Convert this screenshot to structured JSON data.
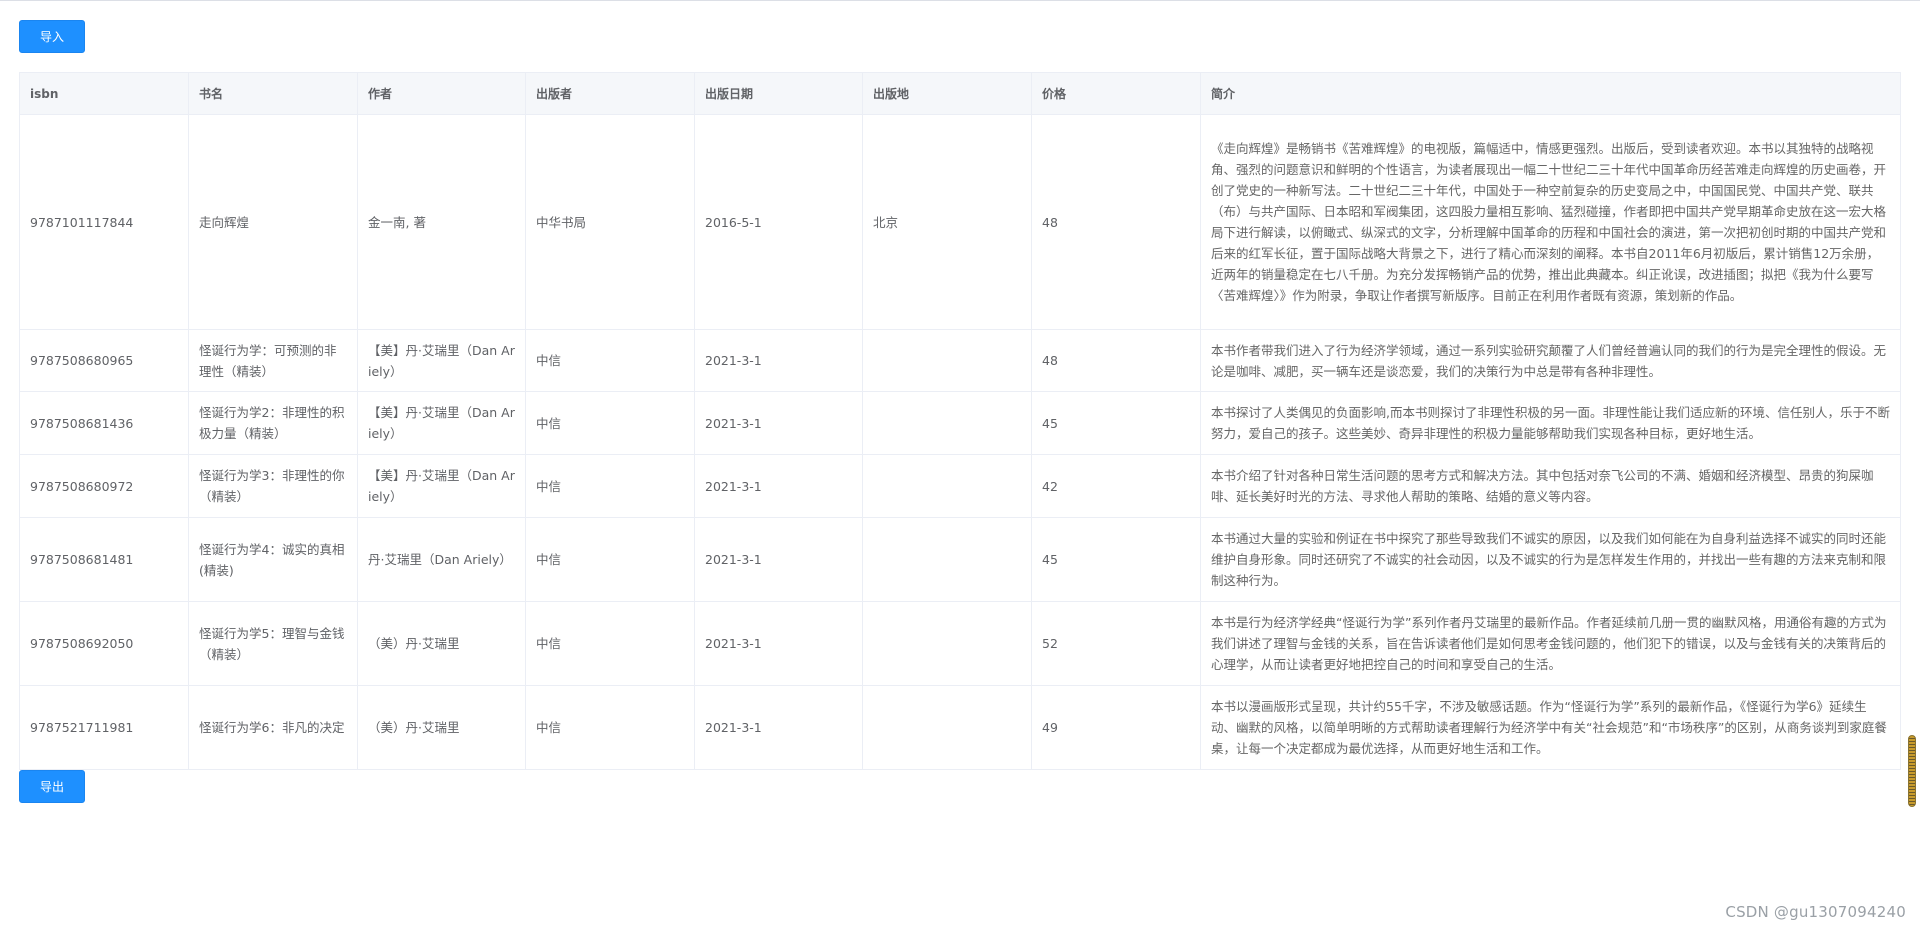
{
  "toolbar": {
    "import_label": "导入",
    "export_label": "导出"
  },
  "table": {
    "headers": [
      "isbn",
      "书名",
      "作者",
      "出版者",
      "出版日期",
      "出版地",
      "价格",
      "简介"
    ],
    "rows": [
      {
        "isbn": "9787101117844",
        "title": "走向辉煌",
        "author": "金一南, 著",
        "publisher": "中华书局",
        "date": "2016-5-1",
        "place": "北京",
        "price": "48",
        "desc": "《走向辉煌》是畅销书《苦难辉煌》的电视版，篇幅适中，情感更强烈。出版后，受到读者欢迎。本书以其独特的战略视角、强烈的问题意识和鲜明的个性语言，为读者展现出一幅二十世纪二三十年代中国革命历经苦难走向辉煌的历史画卷，开创了党史的一种新写法。二十世纪二三十年代，中国处于一种空前复杂的历史变局之中，中国国民党、中国共产党、联共（布）与共产国际、日本昭和军阀集团，这四股力量相互影响、猛烈碰撞，作者即把中国共产党早期革命史放在这一宏大格局下进行解读，以俯瞰式、纵深式的文字，分析理解中国革命的历程和中国社会的演进，第一次把初创时期的中国共产党和后来的红军长征，置于国际战略大背景之下，进行了精心而深刻的阐释。本书自2011年6月初版后，累计销售12万余册，近两年的销量稳定在七八千册。为充分发挥畅销产品的优势，推出此典藏本。纠正讹误，改进插图；拟把《我为什么要写〈苦难辉煌〉》作为附录，争取让作者撰写新版序。目前正在利用作者既有资源，策划新的作品。"
      },
      {
        "isbn": "9787508680965",
        "title": "怪诞行为学：可预测的非理性（精装）",
        "author": "【美】丹·艾瑞里（Dan Ariely）",
        "publisher": "中信",
        "date": "2021-3-1",
        "place": "",
        "price": "48",
        "desc": "本书作者带我们进入了行为经济学领域，通过一系列实验研究颠覆了人们曾经普遍认同的我们的行为是完全理性的假设。无论是咖啡、减肥，买一辆车还是谈恋爱，我们的决策行为中总是带有各种非理性。"
      },
      {
        "isbn": "9787508681436",
        "title": "怪诞行为学2：非理性的积极力量（精装）",
        "author": "【美】丹·艾瑞里（Dan Ariely）",
        "publisher": "中信",
        "date": "2021-3-1",
        "place": "",
        "price": "45",
        "desc": "本书探讨了人类偶见的负面影响,而本书则探讨了非理性积极的另一面。非理性能让我们适应新的环境、信任别人，乐于不断努力，爱自己的孩子。这些美妙、奇异非理性的积极力量能够帮助我们实现各种目标，更好地生活。"
      },
      {
        "isbn": "9787508680972",
        "title": "怪诞行为学3：非理性的你（精装）",
        "author": "【美】丹·艾瑞里（Dan Ariely）",
        "publisher": "中信",
        "date": "2021-3-1",
        "place": "",
        "price": "42",
        "desc": "本书介绍了针对各种日常生活问题的思考方式和解决方法。其中包括对奈飞公司的不满、婚姻和经济模型、昂贵的狗屎咖啡、延长美好时光的方法、寻求他人帮助的策略、结婚的意义等内容。"
      },
      {
        "isbn": "9787508681481",
        "title": "怪诞行为学4：诚实的真相(精装)",
        "author": "丹·艾瑞里（Dan Ariely）",
        "publisher": "中信",
        "date": "2021-3-1",
        "place": "",
        "price": "45",
        "desc": "本书通过大量的实验和例证在书中探究了那些导致我们不诚实的原因，以及我们如何能在为自身利益选择不诚实的同时还能维护自身形象。同时还研究了不诚实的社会动因，以及不诚实的行为是怎样发生作用的，并找出一些有趣的方法来克制和限制这种行为。"
      },
      {
        "isbn": "9787508692050",
        "title": "怪诞行为学5：理智与金钱（精装）",
        "author": "（美）丹·艾瑞里",
        "publisher": "中信",
        "date": "2021-3-1",
        "place": "",
        "price": "52",
        "desc": "本书是行为经济学经典“怪诞行为学”系列作者丹艾瑞里的最新作品。作者延续前几册一贯的幽默风格，用通俗有趣的方式为我们讲述了理智与金钱的关系，旨在告诉读者他们是如何思考金钱问题的，他们犯下的错误，以及与金钱有关的决策背后的心理学，从而让读者更好地把控自己的时间和享受自己的生活。"
      },
      {
        "isbn": "9787521711981",
        "title": "怪诞行为学6：非凡的决定",
        "author": "（美）丹·艾瑞里",
        "publisher": "中信",
        "date": "2021-3-1",
        "place": "",
        "price": "49",
        "desc": "本书以漫画版形式呈现，共计约55千字，不涉及敏感话题。作为“怪诞行为学”系列的最新作品，《怪诞行为学6》延续生动、幽默的风格，以简单明晰的方式帮助读者理解行为经济学中有关“社会规范”和“市场秩序”的区别，从商务谈判到家庭餐桌，让每一个决定都成为最优选择，从而更好地生活和工作。"
      }
    ]
  },
  "watermark": "CSDN @gu1307094240",
  "colors": {
    "primary_button": "#1e90ff",
    "header_bg": "#f5f7fa",
    "border": "#ebeef5"
  }
}
